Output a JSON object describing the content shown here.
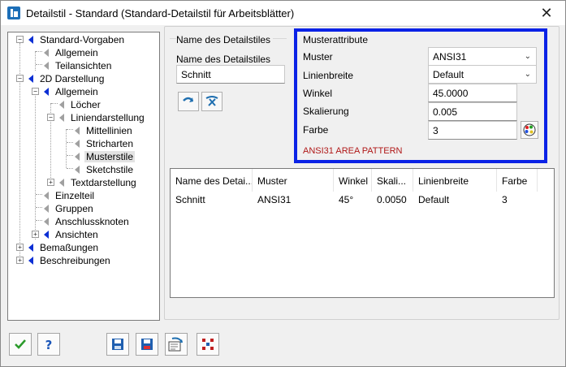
{
  "window": {
    "title": "Detailstil - Standard (Standard-Detailstil für Arbeitsblätter)",
    "close_glyph": "✕"
  },
  "tree": {
    "items": [
      {
        "label": "Standard-Vorgaben",
        "icon": "blue"
      },
      {
        "label": "Allgemein",
        "icon": "gray"
      },
      {
        "label": "Teilansichten",
        "icon": "gray"
      },
      {
        "label": "2D Darstellung",
        "icon": "blue"
      },
      {
        "label": "Allgemein",
        "icon": "blue"
      },
      {
        "label": "Löcher",
        "icon": "gray"
      },
      {
        "label": "Liniendarstellung",
        "icon": "gray"
      },
      {
        "label": "Mittellinien",
        "icon": "gray"
      },
      {
        "label": "Stricharten",
        "icon": "gray"
      },
      {
        "label": "Musterstile",
        "icon": "gray",
        "selected": true
      },
      {
        "label": "Sketchstile",
        "icon": "gray"
      },
      {
        "label": "Textdarstellung",
        "icon": "gray"
      },
      {
        "label": "Einzelteil",
        "icon": "gray"
      },
      {
        "label": "Gruppen",
        "icon": "gray"
      },
      {
        "label": "Anschlussknoten",
        "icon": "gray"
      },
      {
        "label": "Ansichten",
        "icon": "blue"
      },
      {
        "label": "Bemaßungen",
        "icon": "blue"
      },
      {
        "label": "Beschreibungen",
        "icon": "blue"
      }
    ]
  },
  "name_group": {
    "title": "Name des Detailstiles",
    "field_label": "Name des Detailstiles",
    "field_value": "Schnitt"
  },
  "pattern_group": {
    "title": "Musterattribute",
    "muster_label": "Muster",
    "muster_value": "ANSI31",
    "linienbreite_label": "Linienbreite",
    "linienbreite_value": "Default",
    "winkel_label": "Winkel",
    "winkel_value": "45.0000",
    "skalierung_label": "Skalierung",
    "skalierung_value": "0.005",
    "farbe_label": "Farbe",
    "farbe_value": "3",
    "pattern_desc": "ANSI31 AREA PATTERN"
  },
  "table": {
    "headers": [
      "Name des Detai...",
      "Muster",
      "Winkel",
      "Skali...",
      "Linienbreite",
      "Farbe"
    ],
    "rows": [
      [
        "Schnitt",
        "ANSI31",
        "45°",
        "0.0050",
        "Default",
        "3"
      ]
    ]
  },
  "colors": {
    "highlight_border": "#0a22e6",
    "desc_red": "#b01818",
    "tree_blue": "#0c2fd4"
  },
  "icons": [
    "checkmark-icon",
    "help-icon",
    "save-icon",
    "save-as-icon",
    "import-icon",
    "grid-icon",
    "chevron-down-icon",
    "color-palette-icon"
  ]
}
